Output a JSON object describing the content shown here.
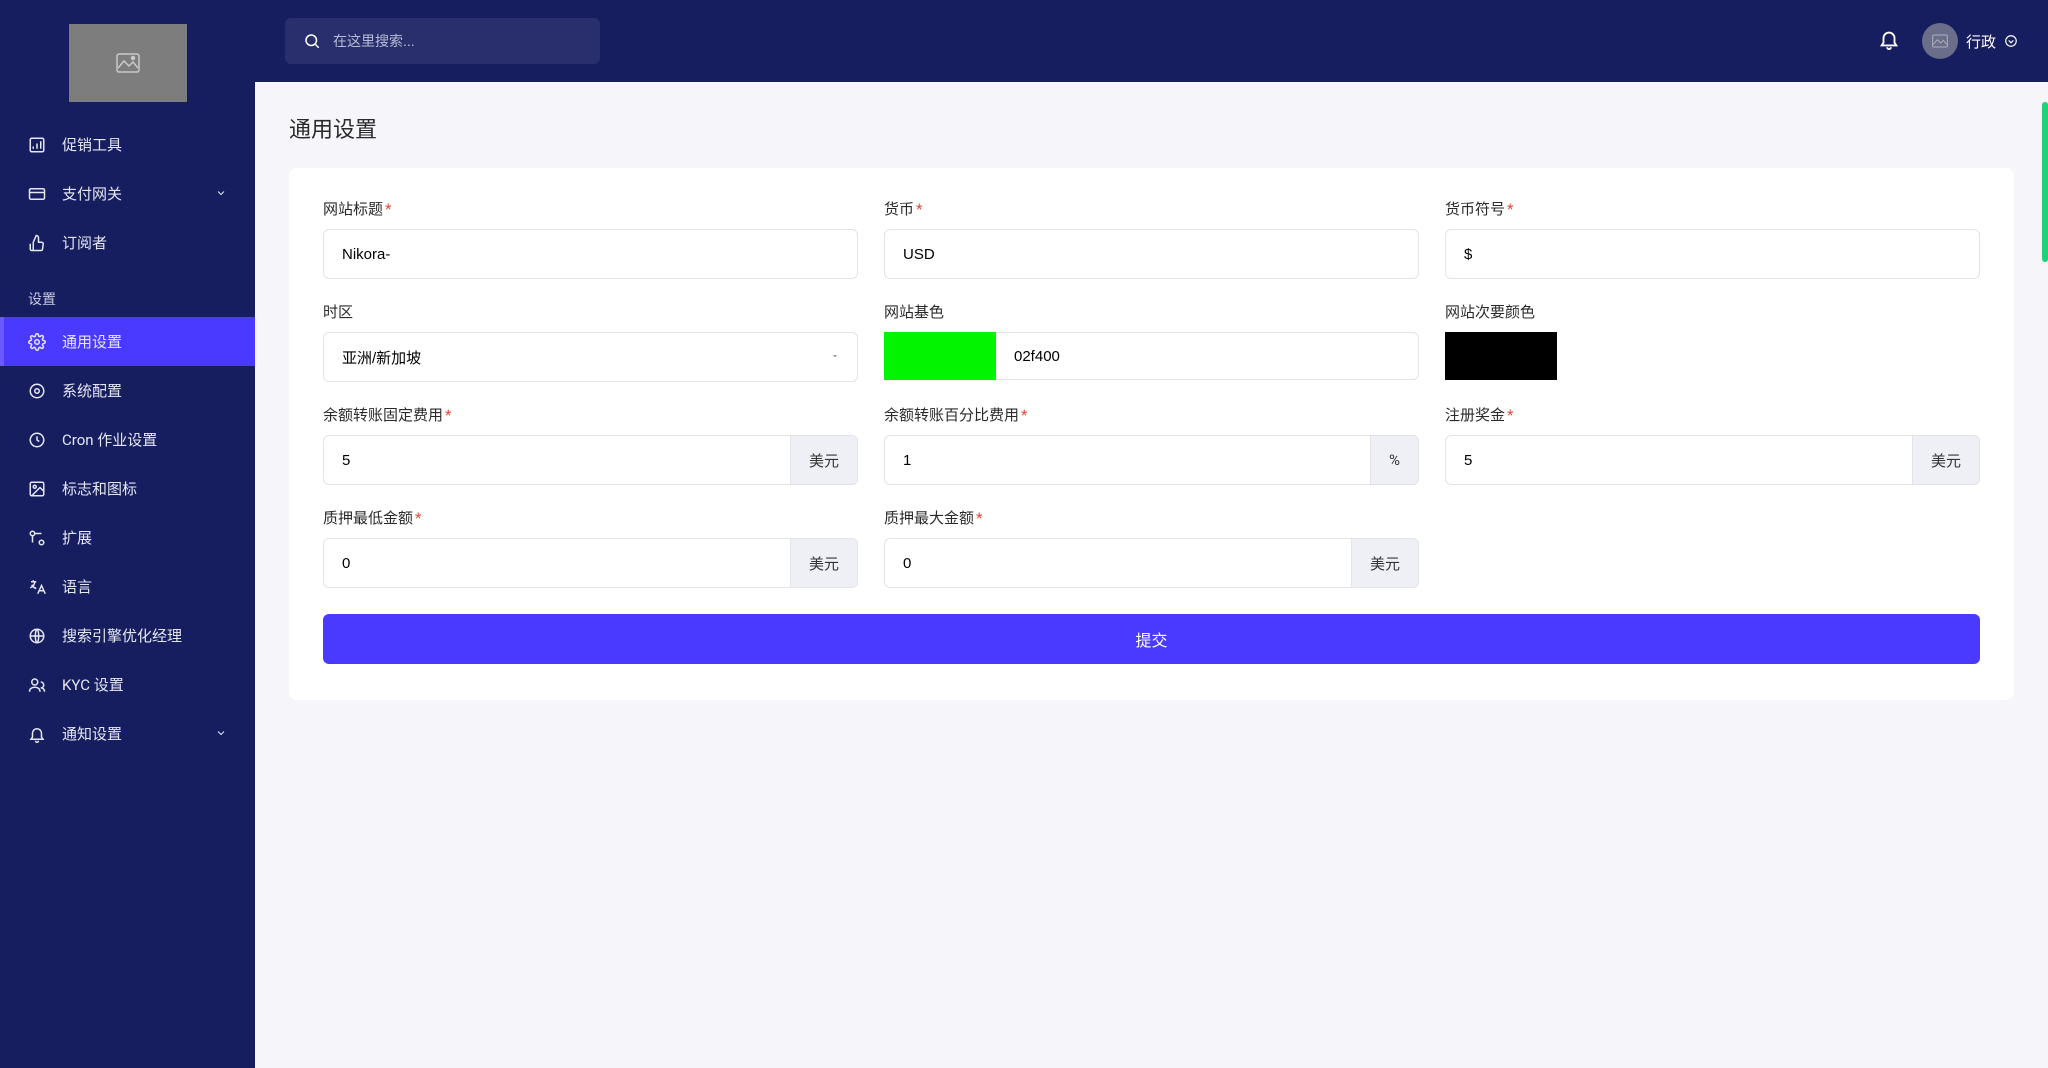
{
  "search": {
    "placeholder": "在这里搜索..."
  },
  "topbar": {
    "user_label": "行政"
  },
  "sidebar": {
    "section_label": "设置",
    "items": {
      "promo": "促销工具",
      "gateway": "支付网关",
      "subscribers": "订阅者",
      "general": "通用设置",
      "system": "系统配置",
      "cron": "Cron 作业设置",
      "logo": "标志和图标",
      "ext": "扩展",
      "lang": "语言",
      "seo": "搜索引擎优化经理",
      "kyc": "KYC 设置",
      "notif": "通知设置"
    }
  },
  "page": {
    "title": "通用设置"
  },
  "form": {
    "site_title": {
      "label": "网站标题",
      "value": "Nikora-"
    },
    "currency": {
      "label": "货币",
      "value": "USD"
    },
    "currency_symbol": {
      "label": "货币符号",
      "value": "$"
    },
    "timezone": {
      "label": "时区",
      "value": "亚洲/新加坡"
    },
    "base_color": {
      "label": "网站基色",
      "hex": "02f400",
      "swatch": "#02f400"
    },
    "secondary_color": {
      "label": "网站次要颜色",
      "hex": "",
      "swatch": "#000000"
    },
    "fixed_fee": {
      "label": "余额转账固定费用",
      "value": "5",
      "addon": "美元"
    },
    "percent_fee": {
      "label": "余额转账百分比费用",
      "value": "1",
      "addon": "%"
    },
    "signup_bonus": {
      "label": "注册奖金",
      "value": "5",
      "addon": "美元"
    },
    "stake_min": {
      "label": "质押最低金额",
      "value": "0",
      "addon": "美元"
    },
    "stake_max": {
      "label": "质押最大金额",
      "value": "0",
      "addon": "美元"
    },
    "submit": "提交"
  }
}
